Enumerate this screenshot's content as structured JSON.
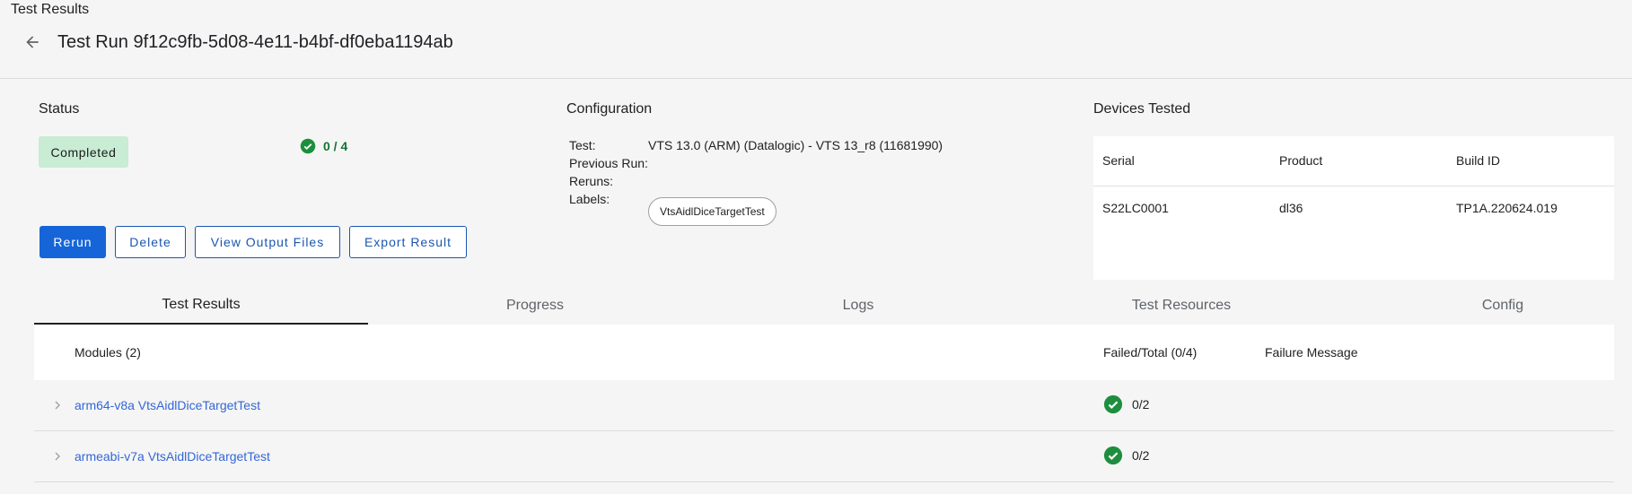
{
  "app": {
    "title": "Test Results"
  },
  "header": {
    "title": "Test Run 9f12c9fb-5d08-4e11-b4bf-df0eba1194ab",
    "back_icon": "arrow-back-icon"
  },
  "status": {
    "label": "Status",
    "chip": "Completed",
    "count": "0 / 4",
    "success_color": "#1e8e3e"
  },
  "actions": {
    "rerun": "Rerun",
    "delete": "Delete",
    "view_output": "View Output Files",
    "export": "Export Result"
  },
  "configuration": {
    "label": "Configuration",
    "test_key": "Test:",
    "test_val": "VTS 13.0 (ARM) (Datalogic) - VTS 13_r8 (11681990)",
    "previous_key": "Previous Run:",
    "reruns_key": "Reruns:",
    "labels_key": "Labels:",
    "labels": [
      "VtsAidlDiceTargetTest"
    ]
  },
  "devices": {
    "label": "Devices Tested",
    "columns": [
      "Serial",
      "Product",
      "Build ID"
    ],
    "rows": [
      [
        "S22LC0001",
        "dl36",
        "TP1A.220624.019"
      ]
    ]
  },
  "tabs": [
    "Test Results",
    "Progress",
    "Logs",
    "Test Resources",
    "Config"
  ],
  "active_tab": "Test Results",
  "results": {
    "modules_header": "Modules (2)",
    "failed_total_header": "Failed/Total (0/4)",
    "failure_message_header": "Failure Message",
    "rows": [
      {
        "module": "arm64-v8a VtsAidlDiceTargetTest",
        "result": "0/2"
      },
      {
        "module": "armeabi-v7a VtsAidlDiceTargetTest",
        "result": "0/2"
      }
    ]
  },
  "colors": {
    "primary": "#1565d8",
    "chip_bg": "#c8ecd4",
    "link": "#3367d6"
  }
}
